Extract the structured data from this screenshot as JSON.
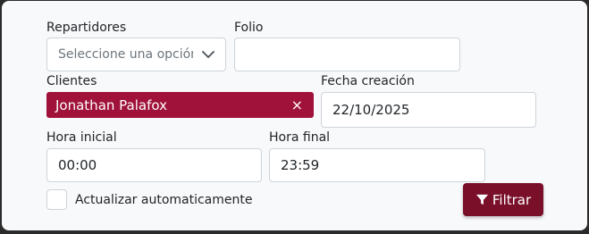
{
  "filters": {
    "repartidores": {
      "label": "Repartidores",
      "placeholder": "Seleccione una opción"
    },
    "folio": {
      "label": "Folio",
      "value": ""
    },
    "clientes": {
      "label": "Clientes",
      "selected": "Jonathan Palafox",
      "remove_glyph": "×"
    },
    "fecha_creacion": {
      "label": "Fecha creación",
      "value": "22/10/2025"
    },
    "hora_inicial": {
      "label": "Hora inicial",
      "value": "00:00"
    },
    "hora_final": {
      "label": "Hora final",
      "value": "23:59"
    },
    "auto_update": {
      "label": "Actualizar automaticamente",
      "checked": false
    },
    "filter_button": {
      "label": "Filtrar",
      "icon": "filter-icon"
    }
  },
  "colors": {
    "tag_background": "#a0123a",
    "button_background": "#7a0f2a",
    "panel_background": "#f8f9fa",
    "page_background": "#2b2b2b"
  }
}
